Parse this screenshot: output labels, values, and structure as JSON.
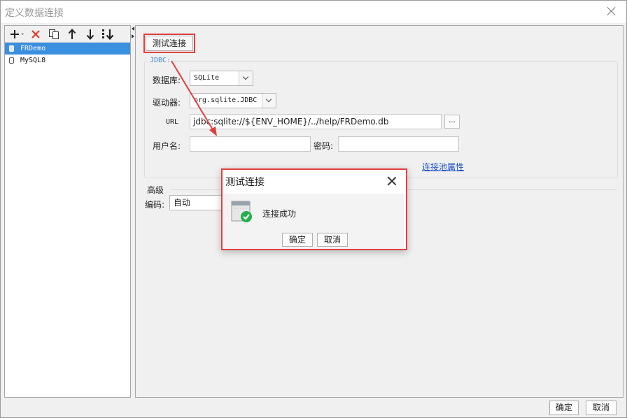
{
  "window": {
    "title": "定义数据连接"
  },
  "left_panel": {
    "toolbar": [
      {
        "name": "add-dropdown-icon",
        "glyph": "+"
      },
      {
        "name": "delete-icon",
        "glyph": "✕"
      },
      {
        "name": "copy-icon",
        "glyph": "⧉"
      },
      {
        "name": "move-up-icon",
        "glyph": "↑"
      },
      {
        "name": "move-down-icon",
        "glyph": "↓"
      },
      {
        "name": "sort-icon",
        "glyph": "⇊"
      }
    ],
    "connections": [
      {
        "label": "FRDemo",
        "selected": true
      },
      {
        "label": "MySQL8",
        "selected": false
      }
    ]
  },
  "right_panel": {
    "test_button": "测试连接",
    "group_legend": "JDBC:",
    "database_label": "数据库:",
    "database_value": "SQLite",
    "driver_label": "驱动器:",
    "driver_value": "org.sqlite.JDBC",
    "url_label": "URL",
    "url_value": "jdbc:sqlite://${ENV_HOME}/../help/FRDemo.db",
    "url_browse": "...",
    "username_label": "用户名:",
    "username_value": "",
    "password_label": "密码:",
    "password_value": "",
    "pool_link": "连接池属性",
    "advanced_title": "高级",
    "encoding_label": "编码:",
    "encoding_value": "自动"
  },
  "dialog": {
    "title": "测试连接",
    "message": "连接成功",
    "ok": "确定",
    "cancel": "取消"
  },
  "footer": {
    "ok": "确定",
    "cancel": "取消"
  },
  "colors": {
    "selection": "#3b8fe0",
    "highlight_red": "#e04040",
    "success_green": "#21b04b",
    "link": "#1a4fc4"
  }
}
